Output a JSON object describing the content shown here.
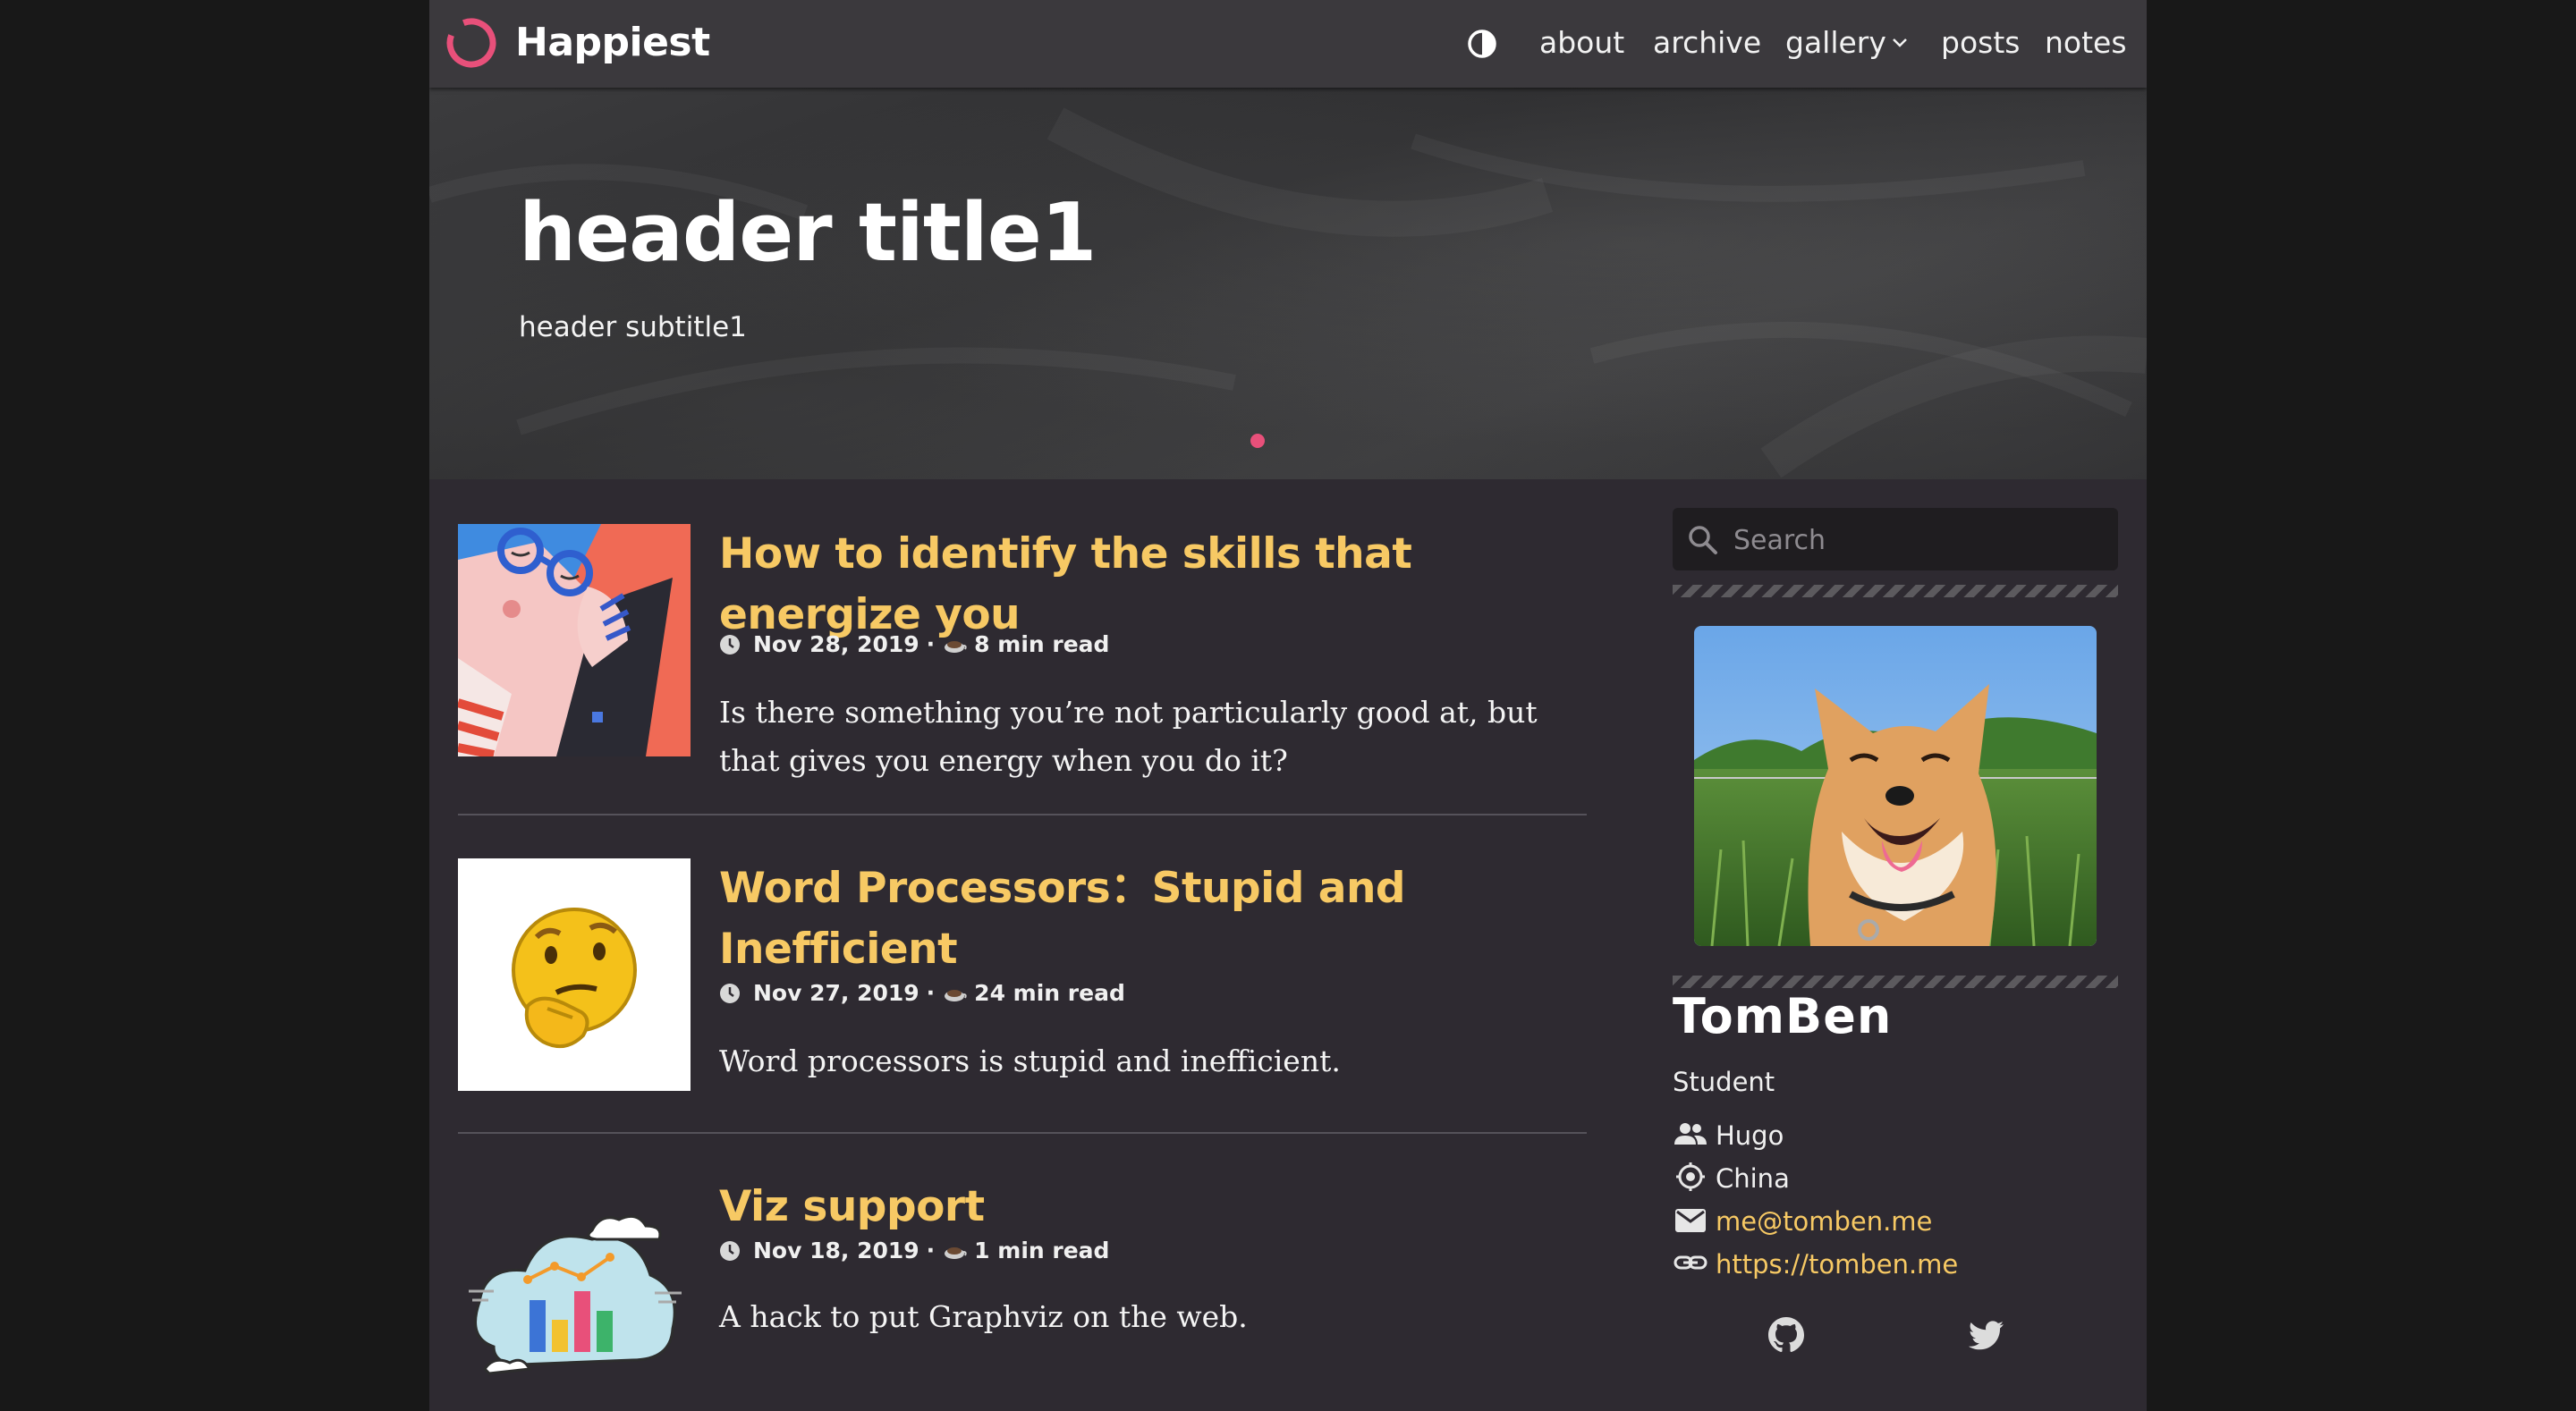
{
  "nav": {
    "brand": "Happiest",
    "links": [
      "about",
      "archive",
      "gallery",
      "posts",
      "notes"
    ],
    "theme_toggle_icon": "contrast-icon",
    "gallery_dropdown_icon": "chevron-down-icon"
  },
  "hero": {
    "title": "header title1",
    "subtitle": "header subtitle1",
    "active_slide": 1
  },
  "posts": [
    {
      "title": "How to identify the skills that energize you",
      "date": "Nov 28, 2019",
      "read_time": "8 min read",
      "summary": "Is there something you’re not particularly good at, but that gives you energy when you do it?",
      "thumbnail": "woman-with-glasses-illustration"
    },
    {
      "title": "Word Processors：Stupid and Inefficient",
      "date": "Nov 27, 2019",
      "read_time": "24 min read",
      "summary": "Word processors is stupid and inefficient.",
      "thumbnail": "thinking-face-emoji"
    },
    {
      "title": "Viz support",
      "date": "Nov 18, 2019",
      "read_time": "1 min read",
      "summary": "A hack to put Graphviz on the web.",
      "thumbnail": "cloud-bar-chart-illustration"
    }
  ],
  "meta_separator": "·",
  "sidebar": {
    "search_placeholder": "Search",
    "profile": {
      "name": "TomBen",
      "role": "Student",
      "organization": "Hugo",
      "location": "China",
      "email": "me@tomben.me",
      "website": "https://tomben.me",
      "avatar": "shiba-inu-photo"
    },
    "social": [
      "github-icon",
      "twitter-icon"
    ]
  },
  "colors": {
    "accent": "#f7c964",
    "brand_pink": "#e8507a",
    "background": "#2e2a31",
    "navbar": "#3b393d"
  }
}
